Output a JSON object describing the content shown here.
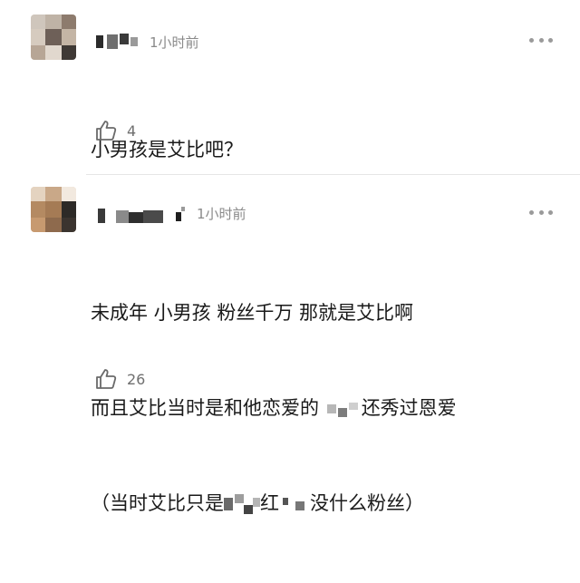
{
  "comments": [
    {
      "time": "1小时前",
      "text_lines": [
        "小男孩是艾比吧？"
      ],
      "likes": "4"
    },
    {
      "time": "1小时前",
      "text_lines": [
        "未成年 小男孩 粉丝千万 那就是艾比啊",
        "而且艾比当时是和他恋爱的",
        "还秀过恩爱",
        "（当时艾比只是",
        "红",
        "没什么粉丝）"
      ],
      "likes": "26"
    }
  ],
  "icons": {
    "more": "more-dots-icon",
    "like": "thumbs-up-icon"
  },
  "colors": {
    "meta_text": "#8a8a8a",
    "body_text": "#1a1a1a",
    "divider": "#e6e6e6"
  }
}
